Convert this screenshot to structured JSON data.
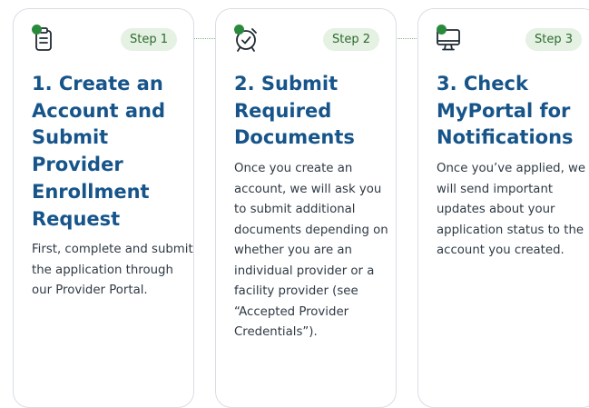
{
  "steps": [
    {
      "pill": "Step 1",
      "icon": "clipboard-icon",
      "title": "1. Create an Account and Submit Provider Enrollment Request",
      "body": "First, complete and submit the application through our Provider Portal."
    },
    {
      "pill": "Step 2",
      "icon": "alarm-clock-icon",
      "title": "2. Submit Required Documents",
      "body": "Once you create an account, we will ask you to submit additional documents depending on whether you are an individual provider or a facility provider (see “Accepted Provider Credentials”)."
    },
    {
      "pill": "Step 3",
      "icon": "monitor-icon",
      "title": "3. Check MyPortal for Notifications",
      "body": "Once you’ve applied, we will send important updates about your application status to the account you created."
    }
  ],
  "colors": {
    "title": "#16548a",
    "pill_bg": "#e4f1e3",
    "pill_text": "#2d6b2d",
    "accent_dot": "#2a8a3c",
    "border": "#d9dde3"
  }
}
